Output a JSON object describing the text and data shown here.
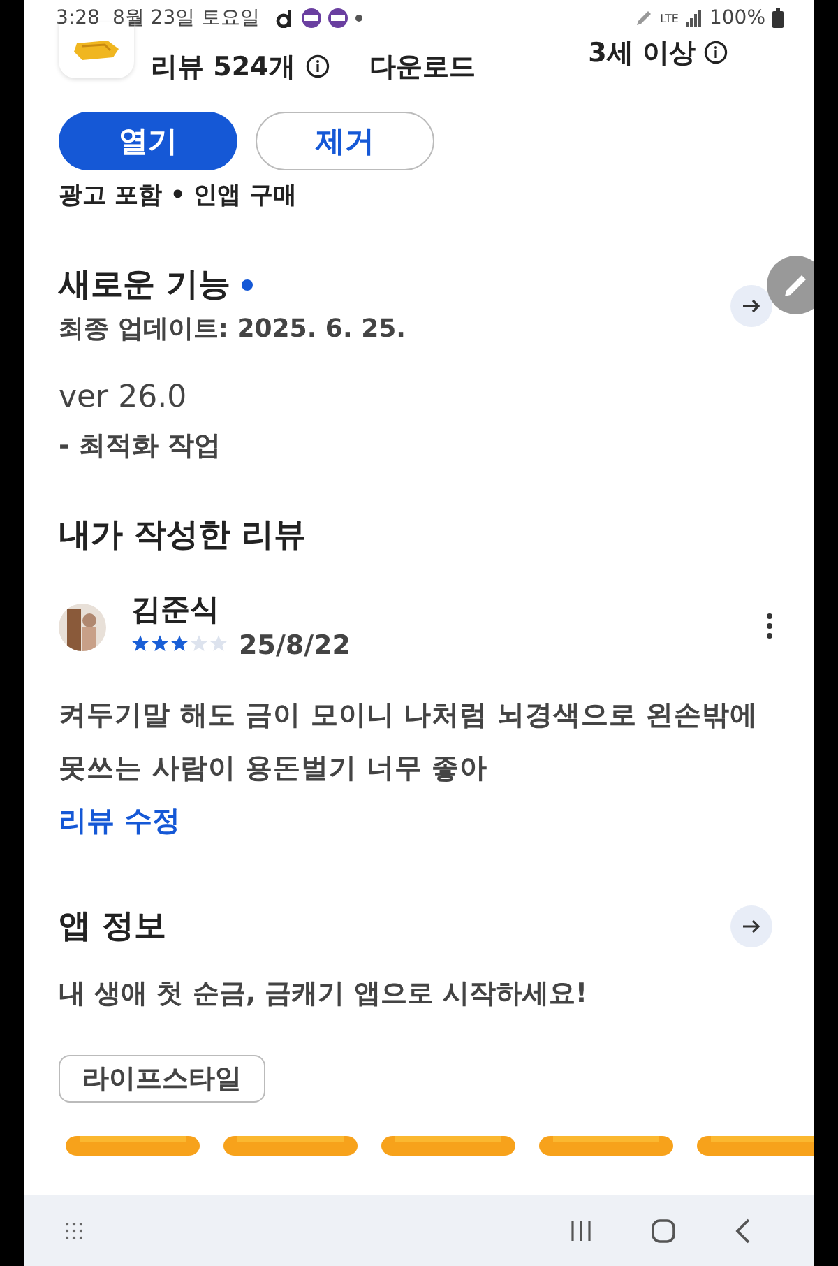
{
  "status_bar": {
    "time": "3:28",
    "date": "8월 23일 토요일",
    "network": "LTE",
    "battery": "100%"
  },
  "app_header": {
    "reviews": "리뷰 524개",
    "downloads": "다운로드",
    "age": "3세 이상"
  },
  "buttons": [
    {
      "label": "열기",
      "kind": "primary"
    },
    {
      "label": "제거",
      "kind": "outline"
    }
  ],
  "notes": "광고 포함 • 인앱 구매",
  "whats_new": {
    "title": "새로운 기능",
    "new": true,
    "updated": "최종 업데이트: 2025. 6. 25.",
    "version": "ver 26.0",
    "changes": "- 최적화 작업"
  },
  "my_review": {
    "title": "내가 작성한 리뷰",
    "author": "김준식",
    "stars": 3,
    "date": "25/8/22",
    "text": "켜두기말 해도 금이 모이니 나처럼 뇌경색으로 왼손밖에 못쓰는 사람이 용돈벌기 너무 좋아",
    "edit_link": "리뷰 수정"
  },
  "app_info": {
    "title": "앱 정보",
    "description": "내 생애 첫 순금, 금캐기 앱으로 시작하세요!",
    "tags": [
      "라이프스타일"
    ]
  }
}
